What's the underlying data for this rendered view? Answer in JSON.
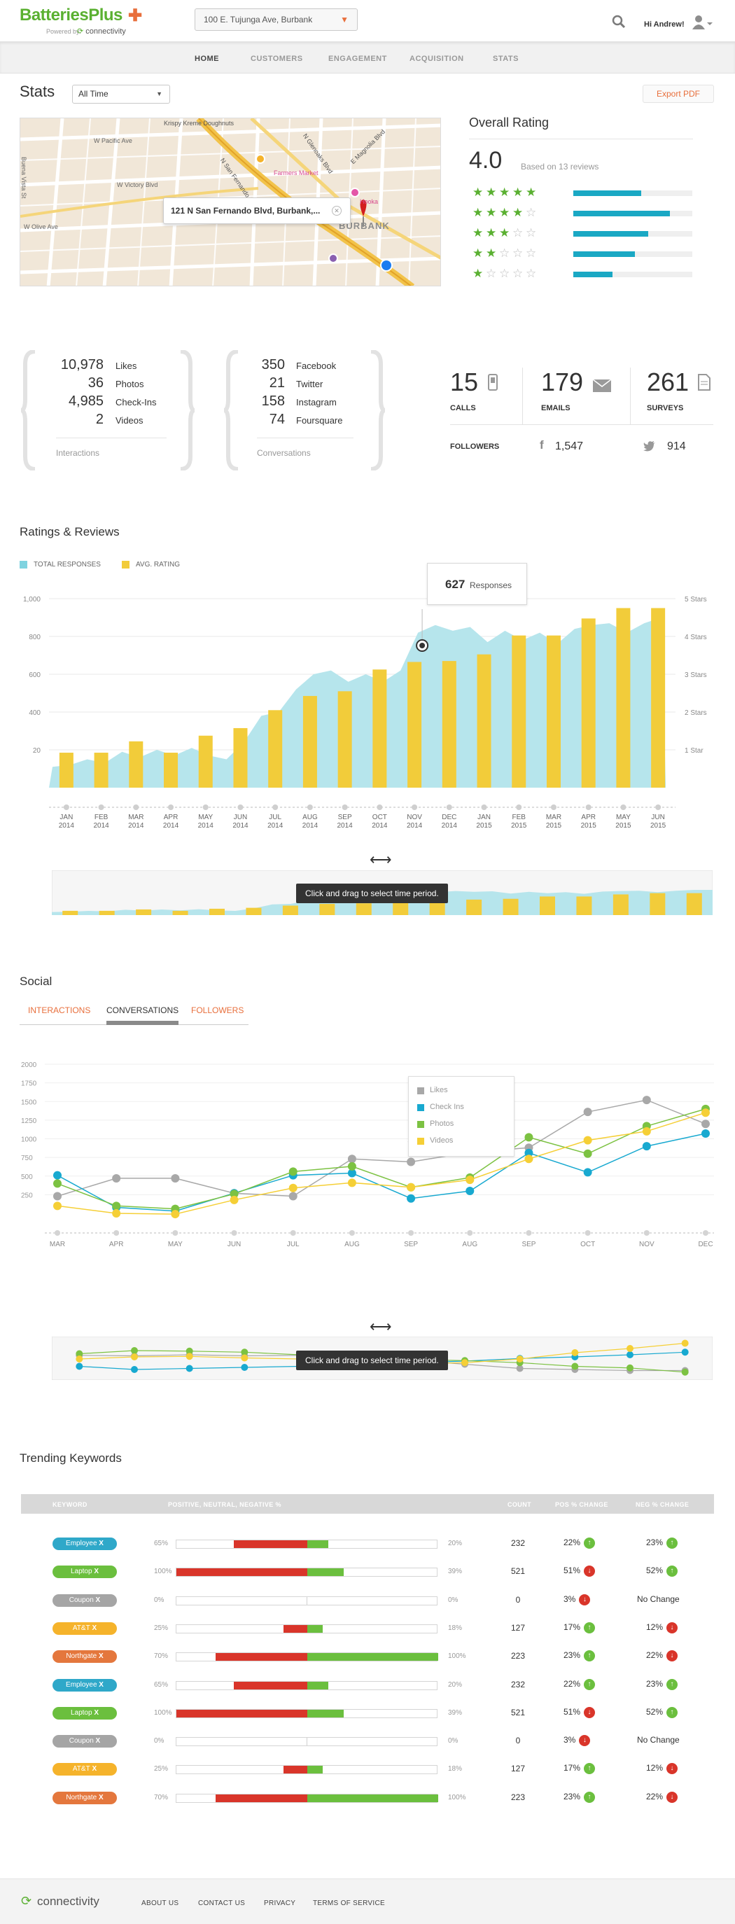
{
  "brand": {
    "name": "BatteriesPlus",
    "powered_by": "Powered by:",
    "powered_name": "connectivity",
    "accent": "#5ab031",
    "accent2": "#e86f3c"
  },
  "header": {
    "location": "100 E. Tujunga Ave, Burbank",
    "greeting": "Hi Andrew!"
  },
  "nav": {
    "items": [
      "HOME",
      "CUSTOMERS",
      "ENGAGEMENT",
      "ACQUISITION",
      "STATS"
    ],
    "active": "HOME"
  },
  "stats": {
    "title": "Stats",
    "range": "All Time",
    "export_label": "Export PDF"
  },
  "map": {
    "address_popup": "121 N San Fernando Blvd, Burbank,...",
    "place_labels": [
      "Krispy Kreme Doughnuts",
      "W Pacific Ave",
      "W Victory Blvd",
      "W Olive Ave",
      "N San Fernando Blvd",
      "N Glenoaks Blvd",
      "E Magnolia Blvd",
      "BURBANK",
      "Farmers Market",
      "Hooka",
      "Buena Vista St"
    ]
  },
  "rating": {
    "title": "Overall Rating",
    "score": "4.0",
    "based_on": "Based on 13 reviews",
    "bars": [
      {
        "stars": 5,
        "fraction": 0.57
      },
      {
        "stars": 4,
        "fraction": 0.81
      },
      {
        "stars": 3,
        "fraction": 0.63
      },
      {
        "stars": 2,
        "fraction": 0.52
      },
      {
        "stars": 1,
        "fraction": 0.33
      }
    ]
  },
  "interactions": {
    "rows": [
      {
        "value": "10,978",
        "label": "Likes"
      },
      {
        "value": "36",
        "label": "Photos"
      },
      {
        "value": "4,985",
        "label": "Check-Ins"
      },
      {
        "value": "2",
        "label": "Videos"
      }
    ],
    "caption": "Interactions"
  },
  "conversations": {
    "rows": [
      {
        "value": "350",
        "label": "Facebook"
      },
      {
        "value": "21",
        "label": "Twitter"
      },
      {
        "value": "158",
        "label": "Instagram"
      },
      {
        "value": "74",
        "label": "Foursquare"
      }
    ],
    "caption": "Conversations"
  },
  "counts": {
    "calls": {
      "value": "15",
      "label": "CALLS"
    },
    "emails": {
      "value": "179",
      "label": "EMAILS"
    },
    "surveys": {
      "value": "261",
      "label": "SURVEYS"
    },
    "followers_label": "FOLLOWERS",
    "facebook_followers": "1,547",
    "twitter_followers": "914"
  },
  "ratings_reviews": {
    "title": "Ratings & Reviews",
    "legend_total": "TOTAL RESPONSES",
    "legend_avg": "AVG. RATING",
    "tooltip_value": "627",
    "tooltip_label": "Responses",
    "drag_hint": "Click and drag to select time period."
  },
  "social": {
    "title": "Social",
    "tabs": [
      "INTERACTIONS",
      "CONVERSATIONS",
      "FOLLOWERS"
    ],
    "active_tab": "CONVERSATIONS",
    "drag_hint": "Click and drag to select time period."
  },
  "keywords": {
    "title": "Trending Keywords",
    "headers": [
      "KEYWORD",
      "POSITIVE, NEUTRAL, NEGATIVE %",
      "COUNT",
      "POS % CHANGE",
      "NEG % CHANGE"
    ],
    "rows": [
      {
        "keyword": "Employee",
        "color": "#2fa8c9",
        "left_pct": "65%",
        "neg": 0.28,
        "pos": 0.08,
        "right_pct": "20%",
        "count": "232",
        "pos_change": "22%",
        "pos_dir": "up",
        "neg_change": "23%",
        "neg_dir": "up"
      },
      {
        "keyword": "Laptop",
        "color": "#6bbf3e",
        "left_pct": "100%",
        "neg": 0.5,
        "pos": 0.14,
        "right_pct": "39%",
        "count": "521",
        "pos_change": "51%",
        "pos_dir": "down",
        "neg_change": "52%",
        "neg_dir": "up"
      },
      {
        "keyword": "Coupon",
        "color": "#a5a5a5",
        "left_pct": "0%",
        "neg": 0.0,
        "pos": 0.0,
        "right_pct": "0%",
        "count": "0",
        "pos_change": "3%",
        "pos_dir": "down",
        "neg_change": "No Change",
        "neg_dir": "none"
      },
      {
        "keyword": "AT&T",
        "color": "#f5b32b",
        "left_pct": "25%",
        "neg": 0.09,
        "pos": 0.06,
        "right_pct": "18%",
        "count": "127",
        "pos_change": "17%",
        "pos_dir": "up",
        "neg_change": "12%",
        "neg_dir": "down"
      },
      {
        "keyword": "Northgate",
        "color": "#e4773d",
        "left_pct": "70%",
        "neg": 0.35,
        "pos": 0.5,
        "right_pct": "100%",
        "count": "223",
        "pos_change": "23%",
        "pos_dir": "up",
        "neg_change": "22%",
        "neg_dir": "down"
      },
      {
        "keyword": "Employee",
        "color": "#2fa8c9",
        "left_pct": "65%",
        "neg": 0.28,
        "pos": 0.08,
        "right_pct": "20%",
        "count": "232",
        "pos_change": "22%",
        "pos_dir": "up",
        "neg_change": "23%",
        "neg_dir": "up"
      },
      {
        "keyword": "Laptop",
        "color": "#6bbf3e",
        "left_pct": "100%",
        "neg": 0.5,
        "pos": 0.14,
        "right_pct": "39%",
        "count": "521",
        "pos_change": "51%",
        "pos_dir": "down",
        "neg_change": "52%",
        "neg_dir": "up"
      },
      {
        "keyword": "Coupon",
        "color": "#a5a5a5",
        "left_pct": "0%",
        "neg": 0.0,
        "pos": 0.0,
        "right_pct": "0%",
        "count": "0",
        "pos_change": "3%",
        "pos_dir": "down",
        "neg_change": "No Change",
        "neg_dir": "none"
      },
      {
        "keyword": "AT&T",
        "color": "#f5b32b",
        "left_pct": "25%",
        "neg": 0.09,
        "pos": 0.06,
        "right_pct": "18%",
        "count": "127",
        "pos_change": "17%",
        "pos_dir": "up",
        "neg_change": "12%",
        "neg_dir": "down"
      },
      {
        "keyword": "Northgate",
        "color": "#e4773d",
        "left_pct": "70%",
        "neg": 0.35,
        "pos": 0.5,
        "right_pct": "100%",
        "count": "223",
        "pos_change": "23%",
        "pos_dir": "up",
        "neg_change": "22%",
        "neg_dir": "down"
      }
    ],
    "up_color": "#6bbf3e",
    "down_color": "#d9352a"
  },
  "footer": {
    "brand": "connectivity",
    "links": [
      "ABOUT US",
      "CONTACT US",
      "PRIVACY",
      "TERMS OF SERVICE"
    ]
  },
  "chart_data": [
    {
      "type": "bar",
      "title": "Ratings & Reviews",
      "categories": [
        "JAN 2014",
        "FEB 2014",
        "MAR 2014",
        "APR 2014",
        "MAY 2014",
        "JUN 2014",
        "JUL 2014",
        "AUG 2014",
        "SEP 2014",
        "OCT 2014",
        "NOV 2014",
        "DEC 2014",
        "JAN 2015",
        "FEB 2015",
        "MAR 2015",
        "APR 2015",
        "MAY 2015",
        "JUN 2015"
      ],
      "y_ticks": [
        "20",
        "400",
        "600",
        "800",
        "1,000"
      ],
      "y2_ticks": [
        "1 Star",
        "2 Stars",
        "3 Stars",
        "4 Stars",
        "5 Stars"
      ],
      "ylim": [
        0,
        1000
      ],
      "series": [
        {
          "name": "AVG. RATING",
          "kind": "bar",
          "color": "#f2cc3a",
          "values": [
            1.85,
            1.85,
            2.45,
            1.85,
            2.75,
            3.15,
            4.1,
            4.85,
            5.1,
            6.25,
            6.65,
            6.7,
            7.05,
            8.05,
            8.05,
            8.95,
            9.5,
            9.5
          ]
        },
        {
          "name": "TOTAL RESPONSES",
          "kind": "area",
          "color": "#b6e5ec",
          "x": [
            0,
            0.5,
            1,
            1.5,
            2,
            2.5,
            3,
            3.5,
            4,
            4.5,
            5,
            5.5,
            6,
            6.5,
            7,
            7.5,
            8,
            8.5,
            9,
            9.5,
            10,
            10.5,
            11,
            11.5,
            12,
            12.5,
            13,
            13.5,
            14,
            14.5,
            15,
            15.5,
            16,
            16.5,
            17,
            17.5
          ],
          "values": [
            110,
            120,
            150,
            130,
            190,
            160,
            200,
            170,
            210,
            170,
            150,
            240,
            380,
            400,
            520,
            600,
            620,
            560,
            600,
            560,
            620,
            820,
            860,
            830,
            850,
            770,
            830,
            780,
            820,
            760,
            840,
            860,
            870,
            820,
            870,
            900
          ]
        }
      ]
    },
    {
      "type": "line",
      "title": "Social",
      "categories": [
        "MAR",
        "APR",
        "MAY",
        "JUN",
        "JUL",
        "AUG",
        "SEP",
        "AUG",
        "SEP",
        "OCT",
        "NOV",
        "DEC"
      ],
      "y_ticks": [
        "250",
        "500",
        "750",
        "1000",
        "1250",
        "1500",
        "1750",
        "2000"
      ],
      "ylim": [
        0,
        2000
      ],
      "series": [
        {
          "name": "Likes",
          "color": "#a8a8a8",
          "x": [
            0,
            1,
            2,
            3,
            4,
            5,
            6,
            7,
            8,
            9,
            10,
            11
          ],
          "values": [
            230,
            470,
            470,
            270,
            230,
            730,
            690,
            820,
            880,
            1360,
            1520,
            1200
          ]
        },
        {
          "name": "Check Ins",
          "color": "#18a9d0",
          "x": [
            0,
            1,
            2,
            3,
            4,
            5,
            6,
            7,
            8,
            9,
            10,
            11
          ],
          "values": [
            510,
            80,
            30,
            270,
            510,
            540,
            200,
            300,
            810,
            550,
            900,
            1070
          ]
        },
        {
          "name": "Photos",
          "color": "#7cc242",
          "x": [
            0,
            1,
            2,
            3,
            4,
            5,
            6,
            7,
            8,
            9,
            10,
            11
          ],
          "values": [
            400,
            100,
            60,
            260,
            560,
            630,
            350,
            480,
            1020,
            800,
            1170,
            1400
          ]
        },
        {
          "name": "Videos",
          "color": "#f5cf36",
          "x": [
            0,
            1,
            2,
            3,
            4,
            5,
            6,
            7,
            8,
            9,
            10,
            11
          ],
          "values": [
            100,
            0,
            -10,
            180,
            340,
            410,
            350,
            450,
            730,
            980,
            1100,
            1350
          ]
        }
      ]
    }
  ]
}
